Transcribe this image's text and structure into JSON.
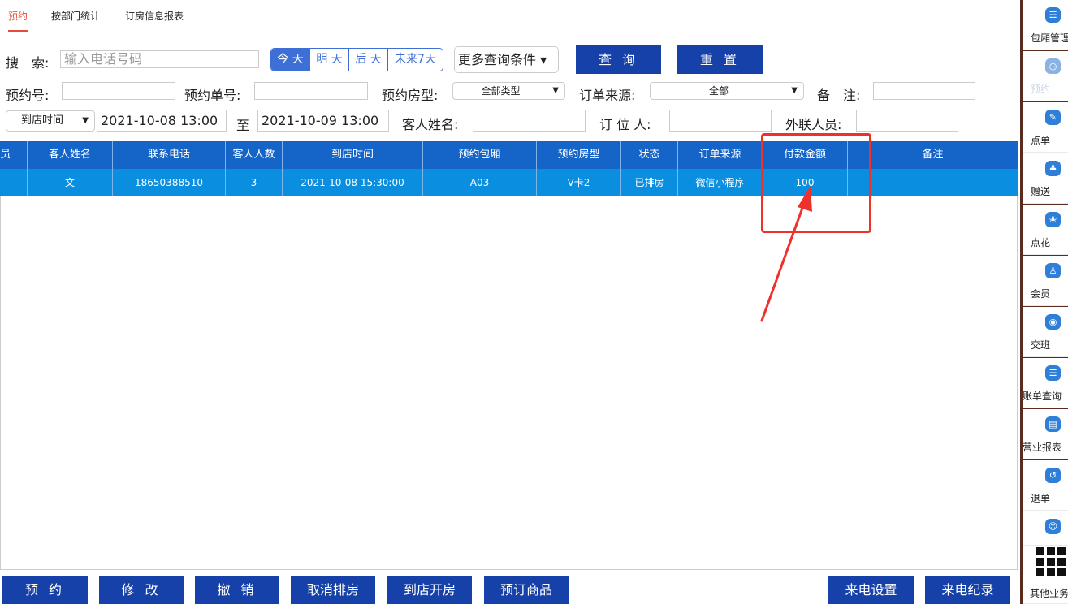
{
  "tabs": [
    {
      "label": "预约",
      "active": true
    },
    {
      "label": "按部门统计",
      "active": false
    },
    {
      "label": "订房信息报表",
      "active": false
    }
  ],
  "search": {
    "label": "搜　索:",
    "placeholder": "输入电话号码",
    "day_buttons": [
      "今 天",
      "明 天",
      "后 天",
      "未来7天"
    ],
    "active_day": "今 天",
    "more_conditions": "更多查询条件 ▾",
    "query_button": "查 询",
    "reset_button": "重 置"
  },
  "filters": {
    "booking_no_label": "预约号:",
    "booking_no_value": "",
    "booking_order_no_label": "预约单号:",
    "booking_order_no_value": "",
    "room_type_label": "预约房型:",
    "room_type_value": "全部类型",
    "order_source_label": "订单来源:",
    "order_source_value": "全部",
    "remark_label": "备　注:",
    "remark_value": "",
    "time_type_value": "到店时间",
    "date_from": "2021-10-08 13:00",
    "to_label": "至",
    "date_to": "2021-10-09 13:00",
    "guest_name_label": "客人姓名:",
    "guest_name_value": "",
    "booker_label": "订 位 人:",
    "booker_value": "",
    "liaison_label": "外联人员:",
    "liaison_value": ""
  },
  "table": {
    "columns": [
      "员",
      "客人姓名",
      "联系电话",
      "客人人数",
      "到店时间",
      "预约包厢",
      "预约房型",
      "状态",
      "订单来源",
      "付款金额",
      "备注"
    ],
    "rows": [
      [
        "",
        "文",
        "18650388510",
        "3",
        "2021-10-08 15:30:00",
        "A03",
        "V卡2",
        "已排房",
        "微信小程序",
        "100",
        ""
      ]
    ]
  },
  "bottom_buttons": [
    "预 约",
    "修 改",
    "撤 销",
    "取消排房",
    "到店开房",
    "预订商品",
    "来电设置",
    "来电纪录"
  ],
  "sidebar": {
    "items": [
      {
        "label": "包厢管理",
        "icon": "grid-icon",
        "dim": false
      },
      {
        "label": "预约",
        "icon": "clock-icon",
        "dim": true
      },
      {
        "label": "点单",
        "icon": "order-icon",
        "dim": false
      },
      {
        "label": "赠送",
        "icon": "gift-icon",
        "dim": false
      },
      {
        "label": "点花",
        "icon": "flower-icon",
        "dim": false
      },
      {
        "label": "会员",
        "icon": "member-icon",
        "dim": false
      },
      {
        "label": "交班",
        "icon": "handover-icon",
        "dim": false
      },
      {
        "label": "账单查询",
        "icon": "bill-icon",
        "dim": false
      },
      {
        "label": "营业报表",
        "icon": "report-icon",
        "dim": false
      },
      {
        "label": "退单",
        "icon": "refund-icon",
        "dim": false
      },
      {
        "label": "",
        "icon": "misc-icon",
        "dim": false
      }
    ],
    "other_label": "其他业务"
  },
  "colors": {
    "tab_active": "#e64a3b",
    "table_header": "#1565c9",
    "selected_row": "#0a8fe0",
    "primary_button": "#1541a8",
    "annotation_red": "#f0302a",
    "sidebar_bg": "#5a2c1e"
  }
}
